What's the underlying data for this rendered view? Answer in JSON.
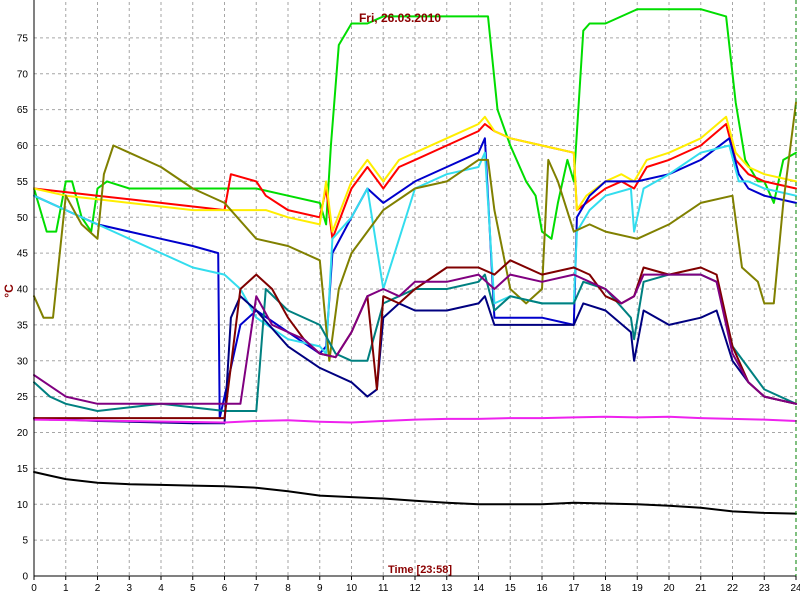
{
  "chart_data": {
    "type": "line",
    "title": "Fri, 26.03.2010",
    "xlabel": "Time [23:58]",
    "ylabel": "°C",
    "xlim": [
      0,
      24
    ],
    "ylim": [
      0,
      80
    ],
    "grid": true,
    "x_ticks": [
      0,
      1,
      2,
      3,
      4,
      5,
      6,
      7,
      8,
      9,
      10,
      11,
      12,
      13,
      14,
      15,
      16,
      17,
      18,
      19,
      20,
      21,
      22,
      23,
      24
    ],
    "y_ticks": [
      0,
      5,
      10,
      15,
      20,
      25,
      30,
      35,
      40,
      45,
      50,
      55,
      60,
      65,
      70,
      75
    ],
    "series": [
      {
        "color": "#00dd00",
        "x": [
          0,
          0.4,
          0.7,
          1,
          1.2,
          1.5,
          1.8,
          2,
          2.3,
          3,
          6,
          6.5,
          7,
          8,
          9,
          9.2,
          9.35,
          9.6,
          10,
          10.5,
          11,
          12,
          13,
          14,
          14.3,
          14.6,
          15,
          15.5,
          15.8,
          16,
          16.3,
          16.5,
          16.8,
          17,
          17.3,
          17.5,
          18,
          19,
          20,
          21,
          21.8,
          22.1,
          22.4,
          22.8,
          23,
          23.3,
          23.6,
          24
        ],
        "values": [
          54,
          48,
          48,
          55,
          55,
          50,
          48,
          54,
          55,
          54,
          54,
          54,
          54,
          53,
          52,
          49,
          60,
          74,
          77,
          77,
          78,
          78,
          78,
          78,
          78,
          65,
          60,
          55,
          53,
          48,
          47,
          52,
          58,
          55,
          76,
          77,
          77,
          79,
          79,
          79,
          78,
          66,
          58,
          55,
          55,
          52,
          58,
          59
        ]
      },
      {
        "color": "#ff0000",
        "x": [
          0,
          1,
          2,
          3,
          4,
          5,
          6,
          6.2,
          7,
          7.3,
          8,
          9,
          9.2,
          9.4,
          10,
          10.5,
          11,
          11.5,
          12,
          13,
          14,
          14.2,
          14.5,
          15,
          16,
          17,
          17.1,
          17.4,
          18,
          18.5,
          18.9,
          19.3,
          20,
          21,
          21.8,
          22.1,
          22.5,
          23,
          24
        ],
        "values": [
          54,
          53.5,
          53,
          52.5,
          52,
          51.5,
          51,
          56,
          55,
          53,
          51,
          50,
          54,
          47,
          54,
          57,
          54,
          57,
          58,
          60,
          62,
          63,
          62,
          61,
          60,
          59,
          51,
          52,
          54,
          55,
          54,
          57,
          58,
          60,
          63,
          58,
          56,
          55,
          54
        ]
      },
      {
        "color": "#ffee00",
        "x": [
          0,
          1,
          2,
          3,
          4,
          5,
          6,
          6.2,
          7,
          7.3,
          8,
          9,
          9.2,
          9.4,
          10,
          10.5,
          11,
          11.5,
          12,
          13,
          14,
          14.2,
          14.5,
          15,
          16,
          17,
          17.1,
          17.4,
          18,
          18.5,
          18.9,
          19.3,
          20,
          21,
          21.8,
          22.1,
          22.5,
          23,
          24
        ],
        "values": [
          54,
          53,
          52.5,
          52,
          51.5,
          51,
          51,
          51,
          51,
          51,
          50,
          49,
          55,
          48,
          55,
          58,
          55,
          58,
          59,
          61,
          63,
          64,
          62,
          61,
          60,
          59,
          51,
          53,
          55,
          56,
          55,
          58,
          59,
          61,
          64,
          59,
          57,
          56,
          55
        ]
      },
      {
        "color": "#0000cc",
        "x": [
          0,
          1,
          2,
          3,
          4,
          5,
          5.8,
          5.85,
          6,
          6.5,
          7,
          8,
          9,
          9.2,
          9.4,
          10,
          10.5,
          11,
          12,
          13,
          14,
          14.2,
          14.5,
          15,
          16,
          17,
          17.1,
          17.5,
          18,
          19,
          20,
          21,
          21.9,
          22.2,
          22.5,
          23,
          24
        ],
        "values": [
          53,
          51,
          49,
          48,
          47,
          46,
          45,
          22,
          25,
          35,
          37,
          34,
          31,
          32,
          45,
          50,
          54,
          52,
          55,
          57,
          59,
          61,
          36,
          36,
          36,
          35,
          50,
          53,
          55,
          55,
          56,
          58,
          61,
          56,
          54,
          53,
          52
        ]
      },
      {
        "color": "#33ddee",
        "x": [
          0,
          1,
          2,
          3,
          4,
          5,
          6,
          6.5,
          7,
          8,
          9,
          9.2,
          9.4,
          10,
          10.5,
          11,
          12,
          13,
          14,
          14.2,
          14.5,
          15,
          16,
          17,
          17.1,
          17.5,
          18,
          18.8,
          18.9,
          19.2,
          20,
          21,
          21.9,
          22.2,
          22.5,
          23,
          24
        ],
        "values": [
          53,
          51,
          49,
          47,
          45,
          43,
          42,
          40,
          36,
          33,
          32,
          31,
          47,
          50,
          54,
          40,
          54,
          56,
          57,
          59,
          38,
          39,
          38,
          38,
          48,
          51,
          53,
          54,
          48,
          54,
          56,
          59,
          60,
          55,
          55,
          54,
          53
        ]
      },
      {
        "color": "#808000",
        "x": [
          0,
          0.3,
          0.6,
          1,
          1.5,
          2,
          2.2,
          2.5,
          3,
          4,
          5,
          6,
          7,
          8,
          9,
          9.3,
          9.6,
          10,
          10.5,
          11,
          12,
          13,
          14,
          14.3,
          14.5,
          15,
          15.5,
          16,
          16.2,
          16.5,
          17,
          17.5,
          18,
          19,
          20,
          21,
          22,
          22.3,
          22.8,
          23,
          23.3,
          23.6,
          24
        ],
        "values": [
          39,
          36,
          36,
          53,
          49,
          47,
          56,
          60,
          59,
          57,
          54,
          52,
          47,
          46,
          44,
          30,
          40,
          45,
          48,
          51,
          54,
          55,
          58,
          58,
          51,
          40,
          38,
          40,
          58,
          55,
          48,
          49,
          48,
          47,
          49,
          52,
          53,
          43,
          41,
          38,
          38,
          52,
          66
        ]
      },
      {
        "color": "#008080",
        "x": [
          0,
          0.5,
          1,
          2,
          3,
          4,
          5,
          6,
          6.5,
          7,
          7.3,
          8,
          9,
          9.5,
          10,
          10.5,
          11,
          11.5,
          12,
          13,
          14,
          14.2,
          14.5,
          15,
          16,
          17,
          17.3,
          18,
          18.8,
          18.9,
          19.2,
          20,
          21,
          21.5,
          22,
          22.5,
          23,
          24
        ],
        "values": [
          27,
          25,
          24,
          23,
          23.5,
          24,
          23.5,
          23,
          23,
          23,
          40,
          37,
          35,
          31,
          30,
          30,
          38,
          39,
          40,
          40,
          41,
          42,
          37,
          39,
          38,
          38,
          41,
          40,
          36,
          33,
          41,
          42,
          42,
          41,
          32,
          29,
          26,
          24
        ]
      },
      {
        "color": "#000080",
        "x": [
          0,
          0.5,
          1,
          2,
          3,
          4,
          5,
          6,
          6.2,
          6.5,
          7,
          8,
          9,
          10,
          10.5,
          10.8,
          11,
          11.5,
          12,
          13,
          14,
          14.2,
          14.5,
          15,
          16,
          17,
          17.3,
          18,
          18.8,
          18.9,
          19.2,
          20,
          21,
          21.5,
          22,
          22.5,
          23,
          24
        ],
        "values": [
          22,
          21.8,
          21.8,
          21.6,
          21.5,
          21.4,
          21.3,
          21.3,
          36,
          39,
          37,
          32,
          29,
          27,
          25,
          26,
          36,
          38,
          37,
          37,
          38,
          39,
          35,
          35,
          35,
          35,
          38,
          37,
          34,
          30,
          37,
          35,
          36,
          37,
          30,
          27,
          25,
          24
        ]
      },
      {
        "color": "#800000",
        "x": [
          0,
          6,
          6.5,
          7,
          7.5,
          8,
          8.5,
          9,
          9.5,
          10,
          10.5,
          10.8,
          11,
          11.5,
          12,
          13,
          14,
          14.5,
          15,
          16,
          17,
          17.5,
          18,
          18.5,
          18.9,
          19.2,
          20,
          21,
          21.5,
          22,
          22.5,
          23,
          24
        ],
        "values": [
          22,
          22,
          40,
          42,
          40,
          36,
          33,
          31,
          30.5,
          34,
          39,
          26,
          39,
          38,
          40,
          43,
          43,
          42,
          44,
          42,
          43,
          42,
          39,
          38,
          39,
          43,
          42,
          43,
          42,
          32,
          27,
          25,
          24
        ]
      },
      {
        "color": "#800080",
        "x": [
          0,
          1,
          2,
          3,
          4,
          5,
          6,
          6.5,
          7,
          7.5,
          8,
          8.5,
          9,
          9.5,
          10,
          10.5,
          11,
          11.5,
          12,
          13,
          14,
          14.5,
          15,
          16,
          17,
          17.5,
          18,
          18.5,
          18.9,
          19.2,
          20,
          21,
          21.5,
          22,
          22.5,
          23,
          24
        ],
        "values": [
          28,
          25,
          24,
          24,
          24,
          24,
          24,
          24,
          39,
          35,
          34,
          33,
          31,
          30.5,
          34,
          39,
          40,
          39,
          41,
          41,
          42,
          40,
          42,
          41,
          42,
          41,
          40,
          38,
          39,
          42,
          42,
          42,
          41,
          31,
          27,
          25,
          24
        ]
      },
      {
        "color": "#ee22ee",
        "x": [
          0,
          6,
          7,
          8,
          9,
          10,
          11,
          12,
          13,
          14,
          15,
          16,
          17,
          18,
          19,
          20,
          21,
          22,
          23,
          24
        ],
        "values": [
          21.8,
          21.4,
          21.6,
          21.7,
          21.5,
          21.4,
          21.6,
          21.8,
          21.9,
          21.9,
          22,
          22,
          22.1,
          22.2,
          22.1,
          22.2,
          22,
          21.9,
          21.8,
          21.6
        ]
      },
      {
        "color": "#000000",
        "x": [
          0,
          0.5,
          1,
          2,
          3,
          4,
          5,
          6,
          7,
          8,
          9,
          10,
          11,
          12,
          13,
          14,
          15,
          16,
          17,
          18,
          19,
          20,
          21,
          22,
          23,
          24
        ],
        "values": [
          14.5,
          14,
          13.5,
          13,
          12.8,
          12.7,
          12.6,
          12.5,
          12.3,
          11.8,
          11.2,
          11,
          10.8,
          10.5,
          10.2,
          10,
          10,
          10,
          10.2,
          10.1,
          10,
          9.8,
          9.5,
          9,
          8.8,
          8.7
        ]
      }
    ]
  }
}
